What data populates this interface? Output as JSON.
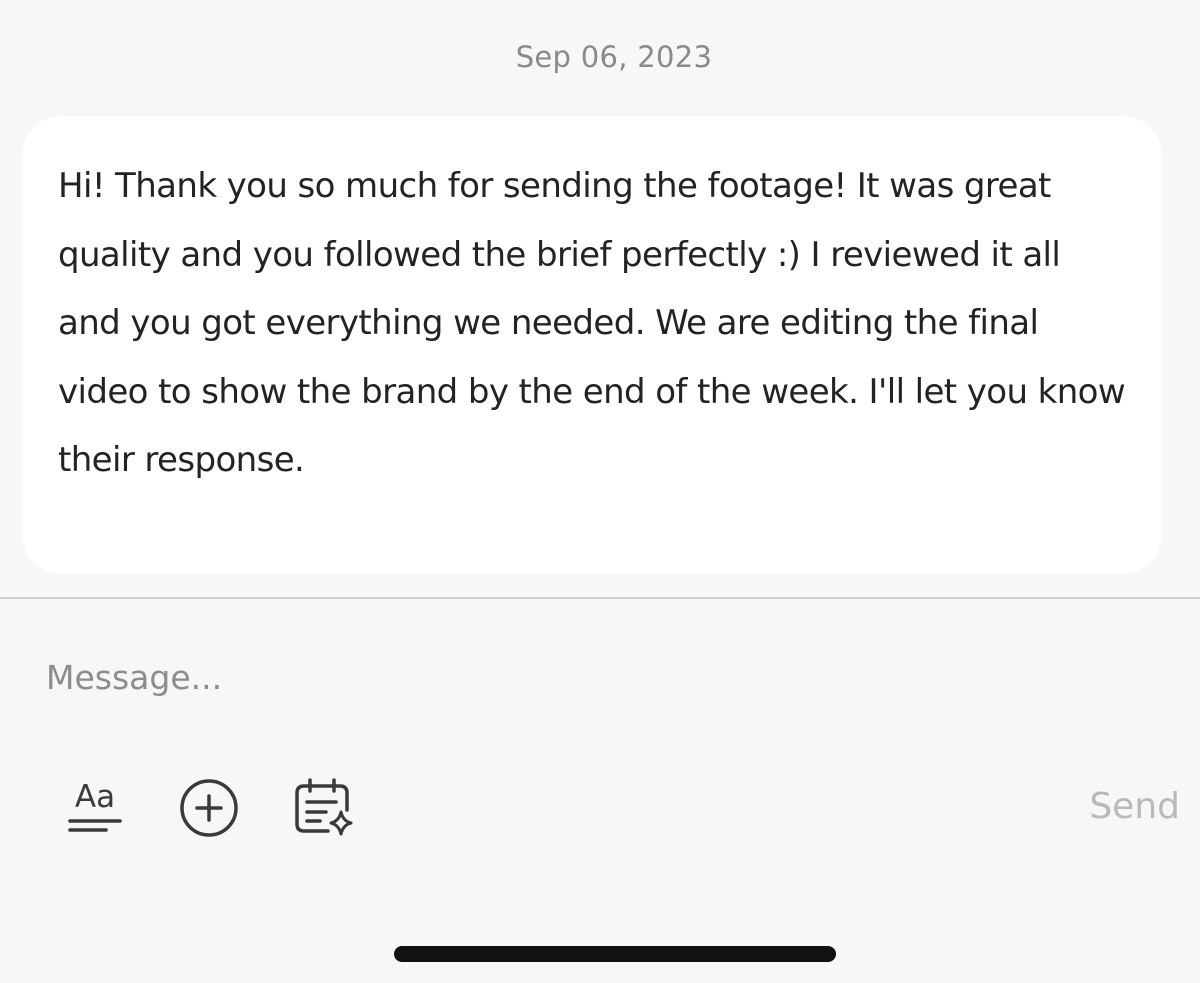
{
  "conversation": {
    "date": "Sep 06, 2023",
    "messages": [
      {
        "text": "Hi! Thank you so much for sending the footage! It was great quality and you followed the brief perfectly :) I reviewed it all and you got everything we needed. We are editing the final video to show the brand by the end of the week. I'll let you know their response."
      }
    ]
  },
  "composer": {
    "placeholder": "Message...",
    "value": "",
    "send_label": "Send",
    "format_label": "Aa",
    "tools": [
      "text-format-icon",
      "add-circle-icon",
      "schedule-sparkle-icon"
    ]
  },
  "colors": {
    "background": "#f7f7f7",
    "bubble": "#ffffff",
    "text": "#232323",
    "muted": "#8a8a8a",
    "send_disabled": "#b9b9b9"
  }
}
